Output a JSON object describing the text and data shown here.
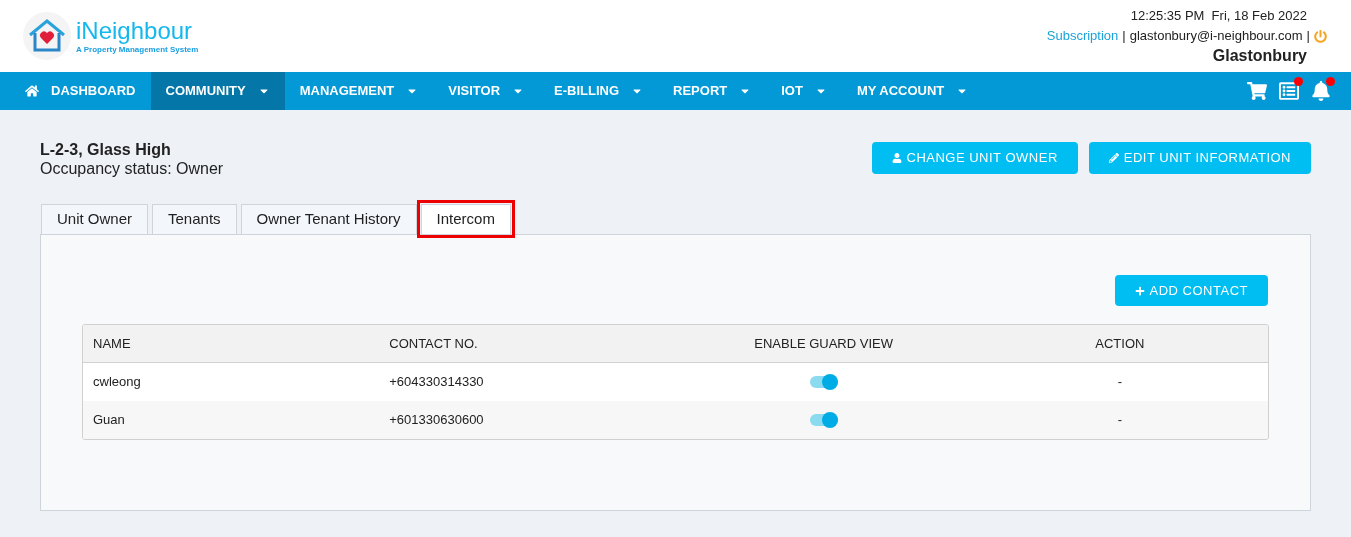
{
  "brand": {
    "name": "iNeighbour",
    "tagline": "A Property Management System"
  },
  "header": {
    "datetime": "12:25:35 PM  Fri, 18 Feb 2022",
    "subscription": "Subscription",
    "separator": "|",
    "email": "glastonbury@i-neighbour.com",
    "separator_2": "|",
    "site": "Glastonbury"
  },
  "nav": [
    {
      "label": "DASHBOARD",
      "kind": "home",
      "selected": false
    },
    {
      "label": "COMMUNITY",
      "kind": "dropdown",
      "selected": true
    },
    {
      "label": "MANAGEMENT",
      "kind": "dropdown",
      "selected": false
    },
    {
      "label": "VISITOR",
      "kind": "dropdown",
      "selected": false
    },
    {
      "label": "E-BILLING",
      "kind": "dropdown",
      "selected": false
    },
    {
      "label": "REPORT",
      "kind": "dropdown",
      "selected": false
    },
    {
      "label": "IOT",
      "kind": "dropdown",
      "selected": false
    },
    {
      "label": "MY ACCOUNT",
      "kind": "dropdown",
      "selected": false
    }
  ],
  "nav_icons": [
    {
      "kind": "cart",
      "badge": false
    },
    {
      "kind": "list",
      "badge": true
    },
    {
      "kind": "bell",
      "badge": true
    }
  ],
  "unit": {
    "title": "L-2-3, Glass High",
    "status": "Occupancy status: Owner"
  },
  "actions": [
    {
      "label": "CHANGE UNIT OWNER",
      "kind": "user"
    },
    {
      "label": "EDIT UNIT INFORMATION",
      "kind": "pencil"
    }
  ],
  "tabs": [
    {
      "label": "Unit Owner",
      "selected": false,
      "highlighted": false
    },
    {
      "label": "Tenants",
      "selected": false,
      "highlighted": false
    },
    {
      "label": "Owner Tenant History",
      "selected": false,
      "highlighted": false
    },
    {
      "label": "Intercom",
      "selected": true,
      "highlighted": true
    }
  ],
  "add_button": "ADD CONTACT",
  "table": {
    "columns": [
      "NAME",
      "CONTACT NO.",
      "ENABLE GUARD VIEW",
      "ACTION"
    ],
    "rows": [
      {
        "name": "cwleong",
        "contact": "+604330314330",
        "guard_view": true,
        "action": "-"
      },
      {
        "name": "Guan",
        "contact": "+601330630600",
        "guard_view": true,
        "action": "-"
      }
    ]
  }
}
